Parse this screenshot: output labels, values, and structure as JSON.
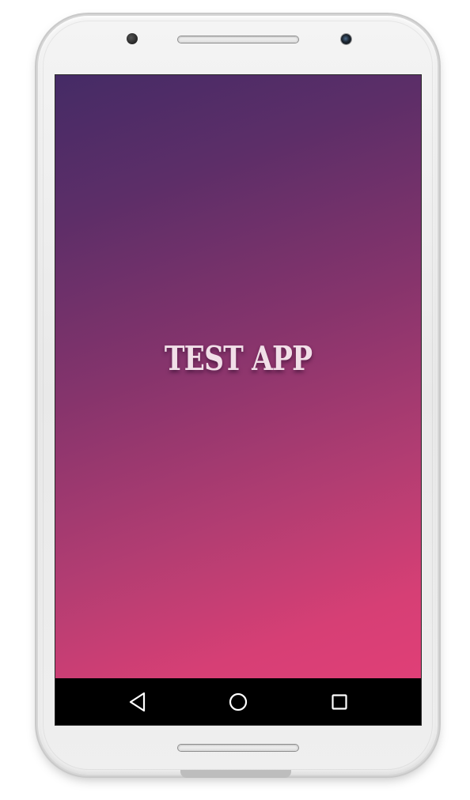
{
  "app": {
    "title": "TEST APP",
    "gradient": {
      "start": "#452b66",
      "end": "#e03f77"
    }
  },
  "nav_bar": {
    "background": "#000000",
    "icon_color": "#ffffff",
    "buttons": [
      {
        "name": "back",
        "icon": "triangle-back-icon"
      },
      {
        "name": "home",
        "icon": "circle-home-icon"
      },
      {
        "name": "recents",
        "icon": "square-recents-icon"
      }
    ]
  },
  "device": {
    "body_color": "#efefef"
  }
}
